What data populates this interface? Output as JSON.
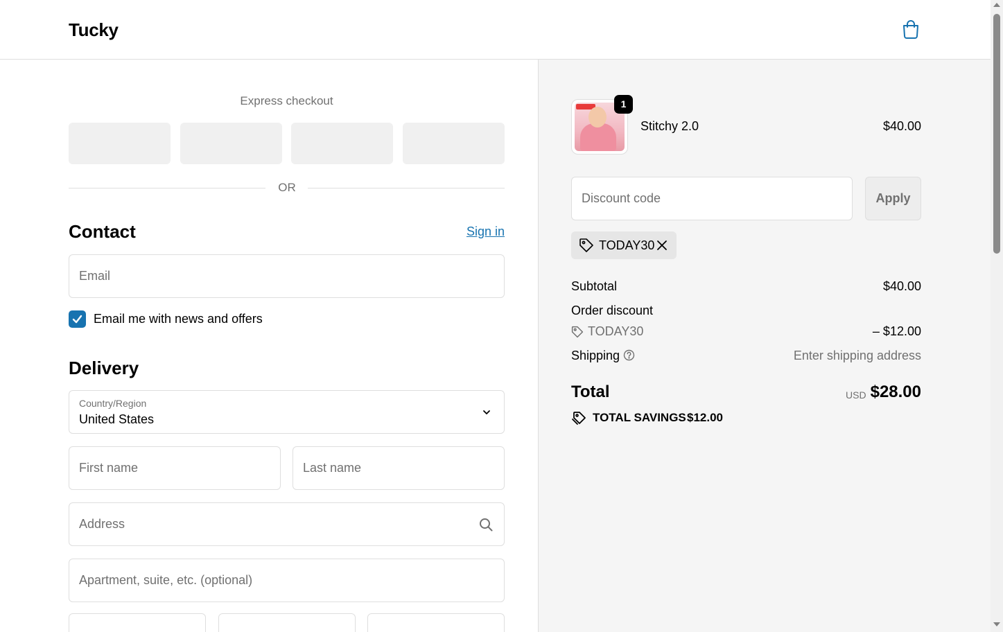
{
  "header": {
    "brand": "Tucky",
    "cart_icon": "shopping-bag-icon"
  },
  "express": {
    "title": "Express checkout",
    "buttons": 4,
    "or": "OR"
  },
  "contact": {
    "heading": "Contact",
    "signin_label": "Sign in",
    "email_placeholder": "Email",
    "newsletter_label": "Email me with news and offers",
    "newsletter_checked": true
  },
  "delivery": {
    "heading": "Delivery",
    "country_label": "Country/Region",
    "country_value": "United States",
    "first_name_placeholder": "First name",
    "last_name_placeholder": "Last name",
    "address_placeholder": "Address",
    "apartment_placeholder": "Apartment, suite, etc. (optional)"
  },
  "summary": {
    "product": {
      "name": "Stitchy 2.0",
      "price": "$40.00",
      "quantity": "1"
    },
    "discount_placeholder": "Discount code",
    "apply_label": "Apply",
    "applied_code": "TODAY30",
    "subtotal_label": "Subtotal",
    "subtotal_value": "$40.00",
    "order_discount_label": "Order discount",
    "order_discount_code": "TODAY30",
    "order_discount_value": "– $12.00",
    "shipping_label": "Shipping",
    "shipping_value": "Enter shipping address",
    "total_label": "Total",
    "total_currency": "USD",
    "total_value": "$28.00",
    "savings_label": "TOTAL SAVINGS",
    "savings_value": "$12.00"
  },
  "colors": {
    "accent": "#1773b0",
    "sidebar_bg": "#f5f5f5",
    "border": "#dedede"
  }
}
